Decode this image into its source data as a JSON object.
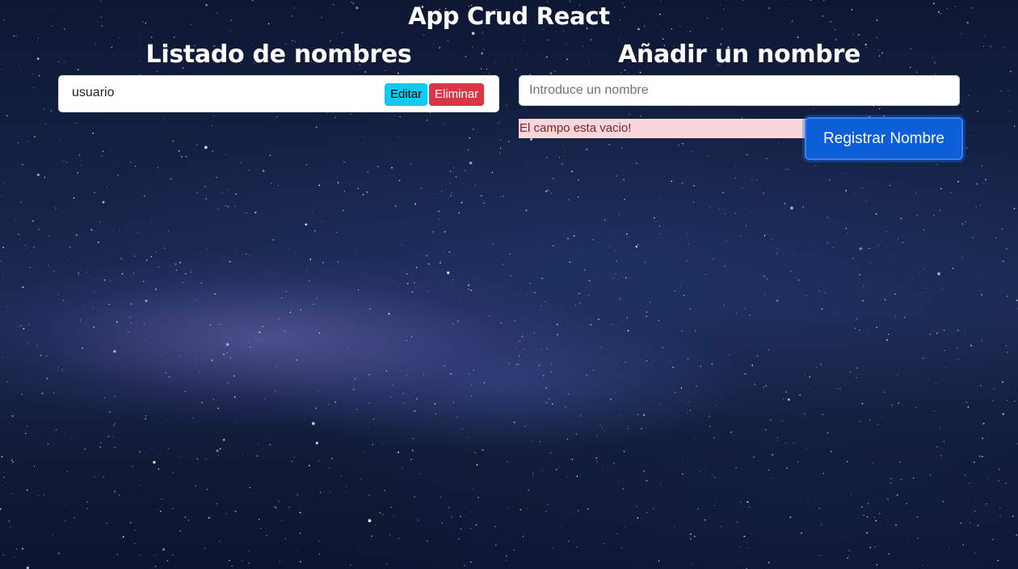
{
  "app": {
    "title": "App Crud React"
  },
  "list": {
    "heading": "Listado de nombres",
    "items": [
      {
        "name": "usuario",
        "edit_label": "Editar",
        "delete_label": "Eliminar"
      }
    ]
  },
  "form": {
    "heading": "Añadir un nombre",
    "input_value": "",
    "input_placeholder": "Introduce un nombre",
    "error_message": "El campo esta vacio!",
    "submit_label": "Registrar Nombre"
  },
  "colors": {
    "edit_button": "#0dcaf0",
    "delete_button": "#dc3545",
    "register_button": "#0d5fd8",
    "error_background": "#f8d7da",
    "error_text": "#842029"
  }
}
